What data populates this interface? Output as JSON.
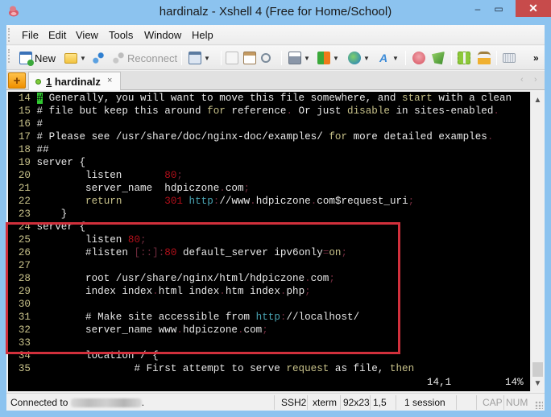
{
  "window": {
    "title": "hardinalz - Xshell 4 (Free for Home/School)",
    "controls": {
      "minimize": "–",
      "maximize": "▭",
      "close": "✕"
    }
  },
  "menu": {
    "items": [
      "File",
      "Edit",
      "View",
      "Tools",
      "Window",
      "Help"
    ]
  },
  "toolbar": {
    "new_label": "New",
    "reconnect_label": "Reconnect",
    "overflow": "»"
  },
  "tabs": {
    "add": "+",
    "items": [
      {
        "number": "1",
        "label": " hardinalz",
        "close": "×",
        "status": "connected"
      }
    ],
    "nav_prev": "‹",
    "nav_next": "›"
  },
  "terminal": {
    "lines": [
      {
        "n": "14",
        "text": "# Generally, you will want to move this file somewhere, and start with a clean"
      },
      {
        "n": "15",
        "text": "# file but keep this around for reference. Or just disable in sites-enabled."
      },
      {
        "n": "16",
        "text": "#"
      },
      {
        "n": "17",
        "text": "# Please see /usr/share/doc/nginx-doc/examples/ for more detailed examples."
      },
      {
        "n": "18",
        "text": "##"
      },
      {
        "n": "19",
        "text": "server {"
      },
      {
        "n": "20",
        "text": "        listen       80;"
      },
      {
        "n": "21",
        "text": "        server_name  hdpiczone.com;"
      },
      {
        "n": "22",
        "text": "        return       301 http://www.hdpiczone.com$request_uri;"
      },
      {
        "n": "23",
        "text": "    }"
      },
      {
        "n": "24",
        "text": "server {"
      },
      {
        "n": "25",
        "text": "        listen 80;"
      },
      {
        "n": "26",
        "text": "        #listen [::]:80 default_server ipv6only=on;"
      },
      {
        "n": "27",
        "text": ""
      },
      {
        "n": "28",
        "text": "        root /usr/share/nginx/html/hdpiczone.com;"
      },
      {
        "n": "29",
        "text": "        index index.html index.htm index.php;"
      },
      {
        "n": "30",
        "text": ""
      },
      {
        "n": "31",
        "text": "        # Make site accessible from http://localhost/"
      },
      {
        "n": "32",
        "text": "        server_name www.hdpiczone.com;"
      },
      {
        "n": "33",
        "text": ""
      },
      {
        "n": "34",
        "text": "        location / {"
      },
      {
        "n": "35",
        "text": "                # First attempt to serve request as file, then"
      }
    ],
    "cursor_position": "14,1",
    "scroll_percent": "14%"
  },
  "statusbar": {
    "connected_prefix": "Connected to",
    "connected_suffix": ".",
    "protocol": "SSH2",
    "terminal_type": "xterm",
    "size": "92x23",
    "cursor": "1,5",
    "sessions": "1 session",
    "cap": "CAP",
    "num": "NUM"
  },
  "colors": {
    "accent_highlight": "#d1303c",
    "terminal_bg": "#000000",
    "keyword": "#c8c28a",
    "number": "#b30f1a",
    "url": "#4aa5b4",
    "cursor": "#31c931"
  }
}
